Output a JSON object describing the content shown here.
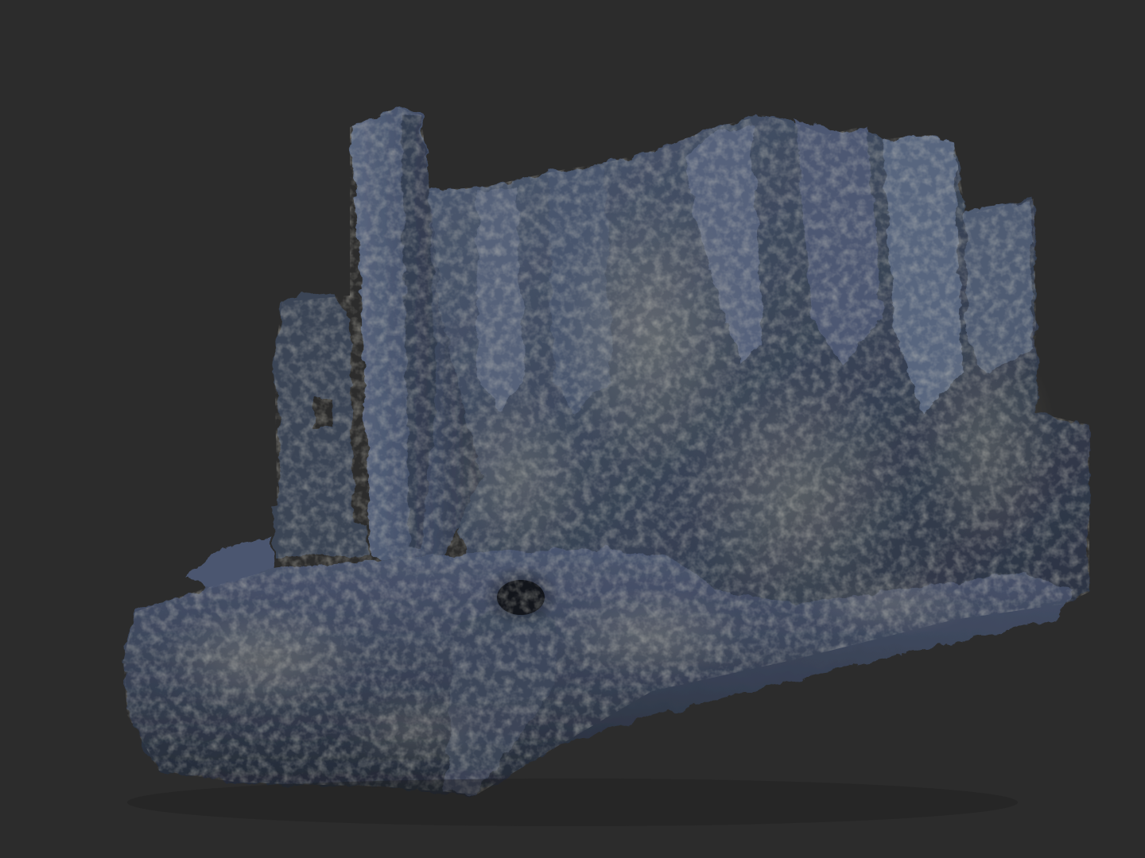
{
  "viewport": {
    "background_color": "#2c2c2c",
    "subject": "sculpted-rock-ruin-model"
  },
  "colors": {
    "rock_base": "#3a4558",
    "rock_mid": "#4a5670",
    "rock_shadow": "#232a36",
    "rock_highlight": "#8d8b7e",
    "rock_light": "#a7a28f"
  }
}
